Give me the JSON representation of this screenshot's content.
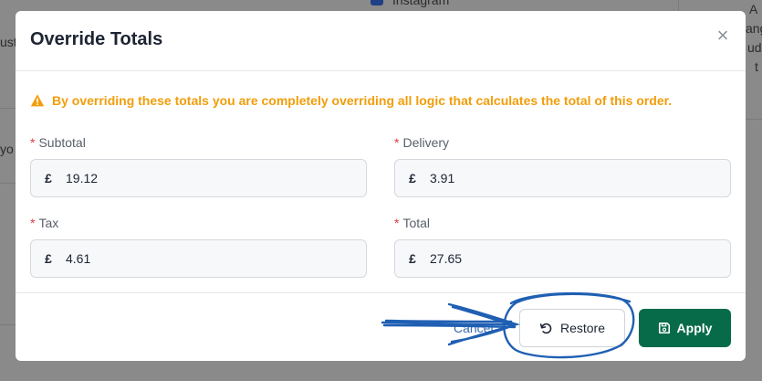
{
  "background": {
    "top_label": "Instagram",
    "left_fragment_1": "ust",
    "left_fragment_2": "yo",
    "right_fragment_1": "A",
    "right_fragment_2": "ang",
    "right_fragment_3": "ud",
    "right_fragment_4": "t"
  },
  "modal": {
    "title": "Override Totals",
    "close_label": "×",
    "warning": "By overriding these totals you are completely overriding all logic that calculates the total of this order.",
    "fields": {
      "subtotal": {
        "label": "Subtotal",
        "currency": "£",
        "value": "19.12"
      },
      "delivery": {
        "label": "Delivery",
        "currency": "£",
        "value": "3.91"
      },
      "tax": {
        "label": "Tax",
        "currency": "£",
        "value": "4.61"
      },
      "total": {
        "label": "Total",
        "currency": "£",
        "value": "27.65"
      }
    },
    "required_marker": "*",
    "footer": {
      "cancel_label": "Cancel",
      "restore_label": "Restore",
      "apply_label": "Apply"
    }
  },
  "colors": {
    "warning": "#f29d0a",
    "apply_button": "#076b4a",
    "required": "#e23b3b",
    "annotation": "#1f5fb3"
  },
  "icons": {
    "warning": "warning-triangle-icon",
    "restore": "undo-icon",
    "apply": "save-icon",
    "close": "close-icon"
  }
}
